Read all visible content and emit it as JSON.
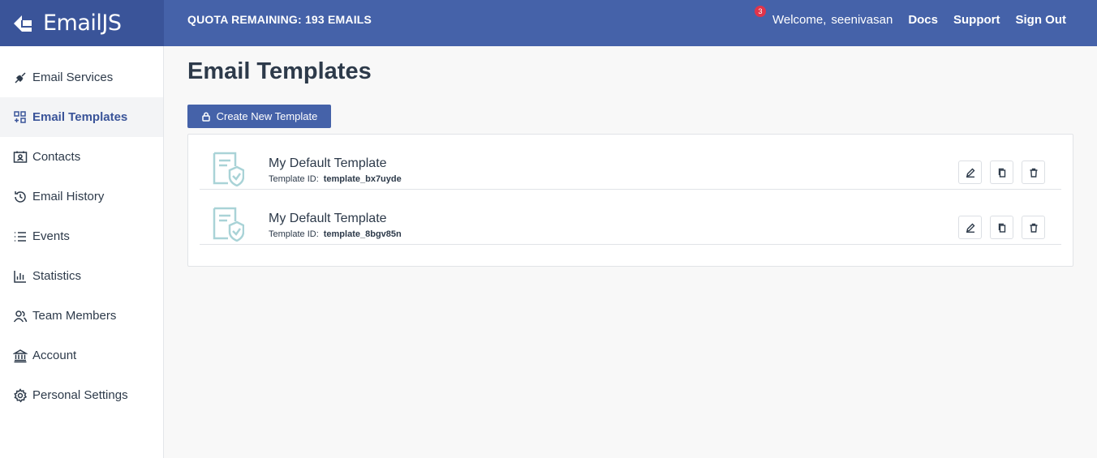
{
  "brand": {
    "name": "EmailJS"
  },
  "header": {
    "quota": "QUOTA REMAINING: 193 EMAILS",
    "notification_count": "3",
    "welcome_label": "Welcome,",
    "username": "seenivasan",
    "links": [
      "Docs",
      "Support",
      "Sign Out"
    ]
  },
  "sidebar": {
    "items": [
      {
        "label": "Email Services",
        "icon": "plug-icon"
      },
      {
        "label": "Email Templates",
        "icon": "templates-icon",
        "active": true
      },
      {
        "label": "Contacts",
        "icon": "contact-card-icon"
      },
      {
        "label": "Email History",
        "icon": "history-icon"
      },
      {
        "label": "Events",
        "icon": "list-icon"
      },
      {
        "label": "Statistics",
        "icon": "bar-chart-icon"
      },
      {
        "label": "Team Members",
        "icon": "team-icon"
      },
      {
        "label": "Account",
        "icon": "bank-icon"
      },
      {
        "label": "Personal Settings",
        "icon": "gear-icon"
      }
    ]
  },
  "main": {
    "title": "Email Templates",
    "create_button": "Create New Template",
    "id_label": "Template ID:",
    "templates": [
      {
        "name": "My Default Template",
        "id": "template_bx7uyde"
      },
      {
        "name": "My Default Template",
        "id": "template_8bgv85n"
      }
    ]
  },
  "colors": {
    "accent": "#4562a9",
    "brand_bg": "#3a5499",
    "badge": "#e0344a",
    "icon_tint": "#a9d3d7"
  }
}
